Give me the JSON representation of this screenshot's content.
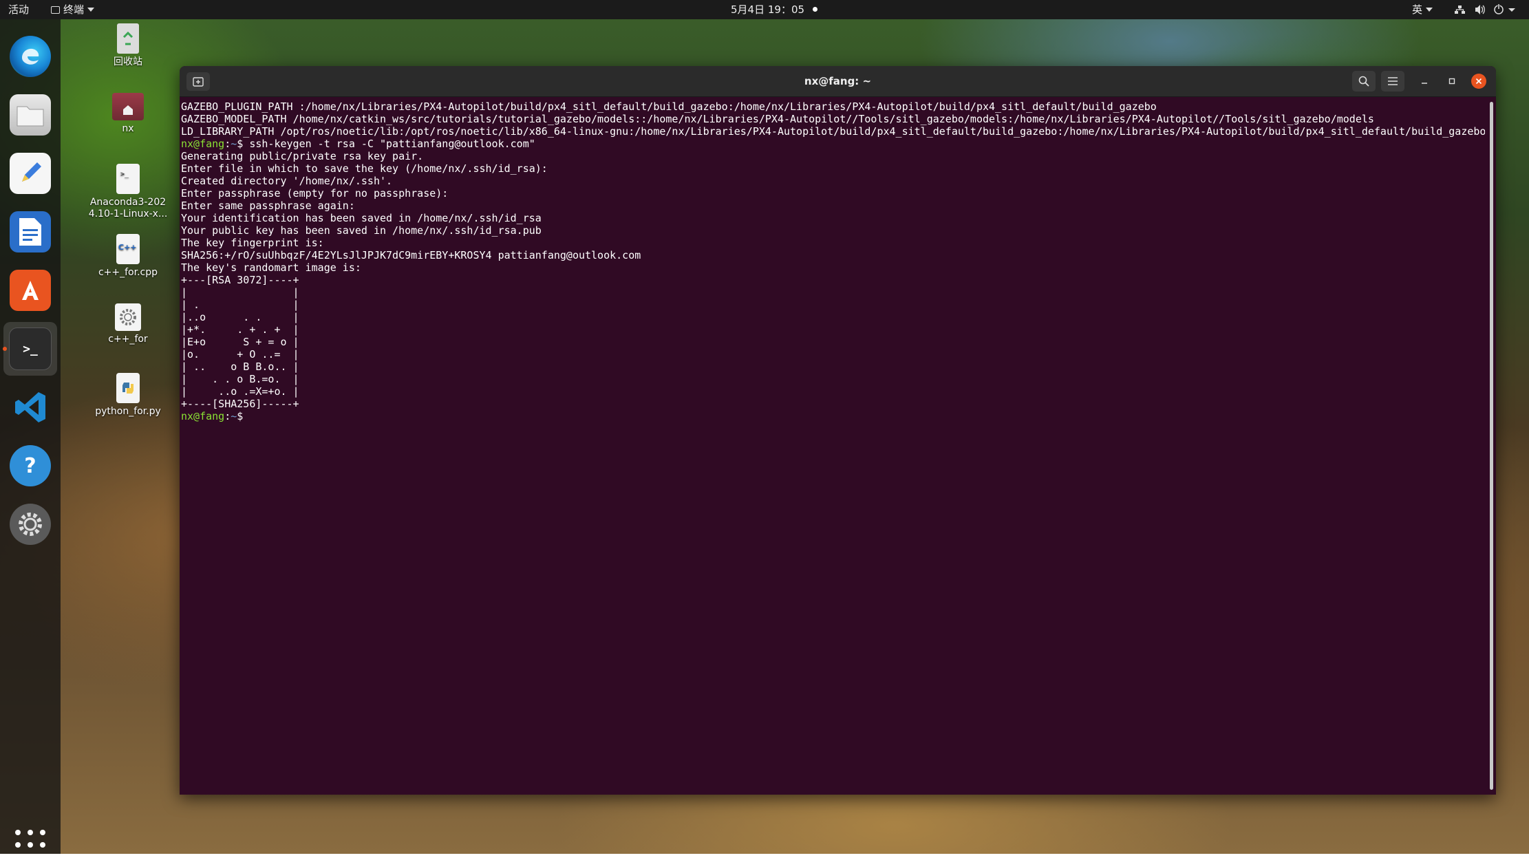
{
  "topbar": {
    "activities": "活动",
    "app_menu": "终端",
    "clock": "5月4日 19：05",
    "input_method": "英"
  },
  "dock": {
    "items": [
      {
        "name": "Microsoft Edge",
        "icon": "edge-icon"
      },
      {
        "name": "Files",
        "icon": "files-icon"
      },
      {
        "name": "Text Editor",
        "icon": "text-editor-icon"
      },
      {
        "name": "LibreOffice Writer",
        "icon": "writer-icon"
      },
      {
        "name": "Ubuntu Software",
        "icon": "software-center-icon"
      },
      {
        "name": "Terminal",
        "icon": "terminal-icon",
        "active": true
      },
      {
        "name": "Visual Studio Code",
        "icon": "vscode-icon"
      },
      {
        "name": "Help",
        "icon": "help-icon"
      },
      {
        "name": "Settings",
        "icon": "settings-icon"
      }
    ],
    "show_apps_icon": "app-grid-icon"
  },
  "desktop_icons": [
    {
      "label": "回收站",
      "icon": "trash-icon"
    },
    {
      "label": "nx",
      "icon": "home-folder-icon"
    },
    {
      "label": "Anaconda3-202\n4.10-1-Linux-x...",
      "icon": "shell-script-icon"
    },
    {
      "label": "c++_for.cpp",
      "icon": "cpp-file-icon"
    },
    {
      "label": "c++_for",
      "icon": "executable-icon"
    },
    {
      "label": "python_for.py",
      "icon": "python-file-icon"
    }
  ],
  "terminal": {
    "title": "nx@fang: ~",
    "prompt_user": "nx@fang",
    "prompt_path": "~",
    "lines": [
      {
        "text": "GAZEBO_PLUGIN_PATH :/home/nx/Libraries/PX4-Autopilot/build/px4_sitl_default/build_gazebo:/home/nx/Libraries/PX4-Autopilot/build/px4_sitl_default/build_gazebo"
      },
      {
        "text": "GAZEBO_MODEL_PATH /home/nx/catkin_ws/src/tutorials/tutorial_gazebo/models::/home/nx/Libraries/PX4-Autopilot//Tools/sitl_gazebo/models:/home/nx/Libraries/PX4-Autopilot//Tools/sitl_gazebo/models"
      },
      {
        "text": "LD_LIBRARY_PATH /opt/ros/noetic/lib:/opt/ros/noetic/lib/x86_64-linux-gnu:/home/nx/Libraries/PX4-Autopilot/build/px4_sitl_default/build_gazebo:/home/nx/Libraries/PX4-Autopilot/build/px4_sitl_default/build_gazebo"
      },
      {
        "prompt": true,
        "text": "$ ssh-keygen -t rsa -C \"pattianfang@outlook.com\""
      },
      {
        "text": "Generating public/private rsa key pair."
      },
      {
        "text": "Enter file in which to save the key (/home/nx/.ssh/id_rsa):"
      },
      {
        "text": "Created directory '/home/nx/.ssh'."
      },
      {
        "text": "Enter passphrase (empty for no passphrase):"
      },
      {
        "text": "Enter same passphrase again:"
      },
      {
        "text": "Your identification has been saved in /home/nx/.ssh/id_rsa"
      },
      {
        "text": "Your public key has been saved in /home/nx/.ssh/id_rsa.pub"
      },
      {
        "text": "The key fingerprint is:"
      },
      {
        "text": "SHA256:+/rO/suUhbqzF/4E2YLsJlJPJK7dC9mirEBY+KROSY4 pattianfang@outlook.com"
      },
      {
        "text": "The key's randomart image is:"
      },
      {
        "text": "+---[RSA 3072]----+"
      },
      {
        "text": "|                 |"
      },
      {
        "text": "| .               |"
      },
      {
        "text": "|..o      . .     |"
      },
      {
        "text": "|+*.     . + . +  |"
      },
      {
        "text": "|E+o      S + = o |"
      },
      {
        "text": "|o.      + O ..=  |"
      },
      {
        "text": "| ..    o B B.o.. |"
      },
      {
        "text": "|    . . o B.=o.  |"
      },
      {
        "text": "|     ..o .=X=+o. |"
      },
      {
        "text": "+----[SHA256]-----+"
      },
      {
        "prompt": true,
        "text": "$ "
      }
    ]
  },
  "colors": {
    "terminal_bg": "#300a24",
    "prompt_user": "#8ae234",
    "prompt_path": "#729fcf",
    "accent": "#e95420"
  }
}
